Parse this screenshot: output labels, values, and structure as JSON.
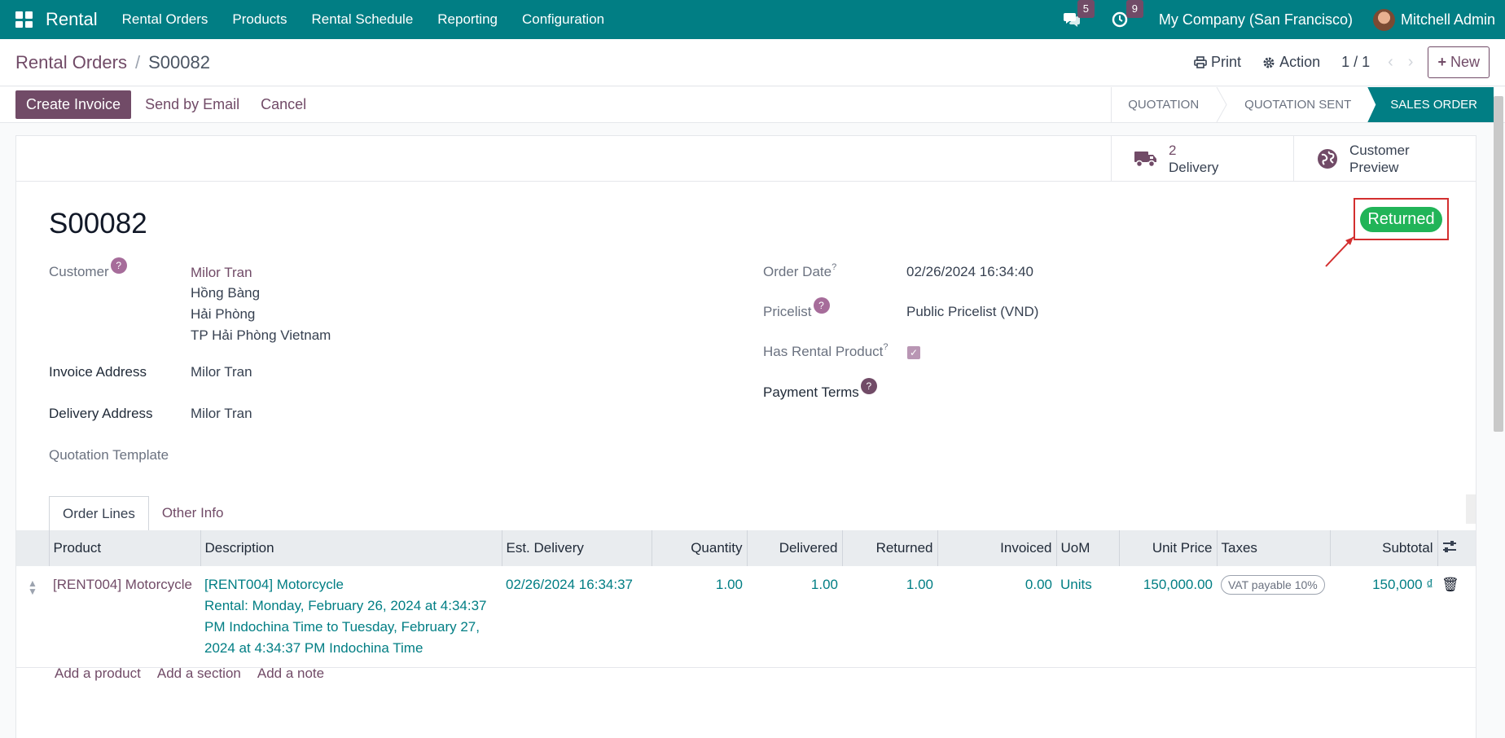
{
  "app": {
    "name": "Rental"
  },
  "topnav": {
    "items": [
      "Rental Orders",
      "Products",
      "Rental Schedule",
      "Reporting",
      "Configuration"
    ],
    "messages_count": "5",
    "activities_count": "9",
    "company": "My Company (San Francisco)",
    "user": "Mitchell Admin"
  },
  "breadcrumb": {
    "parent": "Rental Orders",
    "separator": "/",
    "current": "S00082"
  },
  "controls": {
    "print": "Print",
    "action": "Action",
    "pager": "1 / 1",
    "new": "New"
  },
  "actions": {
    "create_invoice": "Create Invoice",
    "send_email": "Send by Email",
    "cancel": "Cancel"
  },
  "stages": [
    "QUOTATION",
    "QUOTATION SENT",
    "SALES ORDER"
  ],
  "smart_buttons": {
    "delivery_count": "2",
    "delivery_label": "Delivery",
    "preview_line1": "Customer",
    "preview_line2": "Preview"
  },
  "record": {
    "name": "S00082",
    "status": "Returned",
    "customer_label": "Customer",
    "customer_name": "Milor Tran",
    "address_line1": "Hồng Bàng",
    "address_line2": "Hải Phòng",
    "address_line3": "TP Hải Phòng Vietnam",
    "invoice_address_label": "Invoice Address",
    "invoice_address": "Milor Tran",
    "delivery_address_label": "Delivery Address",
    "delivery_address": "Milor Tran",
    "quotation_template_label": "Quotation Template",
    "order_date_label": "Order Date",
    "order_date": "02/26/2024 16:34:40",
    "pricelist_label": "Pricelist",
    "pricelist": "Public Pricelist (VND)",
    "has_rental_label": "Has Rental Product",
    "has_rental": true,
    "payment_terms_label": "Payment Terms"
  },
  "tabs": [
    "Order Lines",
    "Other Info"
  ],
  "table": {
    "headers": [
      "Product",
      "Description",
      "Est. Delivery",
      "Quantity",
      "Delivered",
      "Returned",
      "Invoiced",
      "UoM",
      "Unit Price",
      "Taxes",
      "Subtotal"
    ],
    "rows": [
      {
        "product": "[RENT004] Motorcycle",
        "description_line1": "[RENT004] Motorcycle",
        "description_line2": "Rental: Monday, February 26, 2024 at 4:34:37",
        "description_line3": "PM Indochina Time to Tuesday, February 27,",
        "description_line4": "2024 at 4:34:37 PM Indochina Time",
        "est_delivery": "02/26/2024 16:34:37",
        "quantity": "1.00",
        "delivered": "1.00",
        "returned": "1.00",
        "invoiced": "0.00",
        "uom": "Units",
        "unit_price": "150,000.00",
        "taxes": "VAT payable 10%",
        "subtotal": "150,000 ₫"
      }
    ],
    "add_product": "Add a product",
    "add_section": "Add a section",
    "add_note": "Add a note"
  },
  "colors": {
    "topbar": "#017e84",
    "accent": "#714b67",
    "returned": "#21b458"
  }
}
